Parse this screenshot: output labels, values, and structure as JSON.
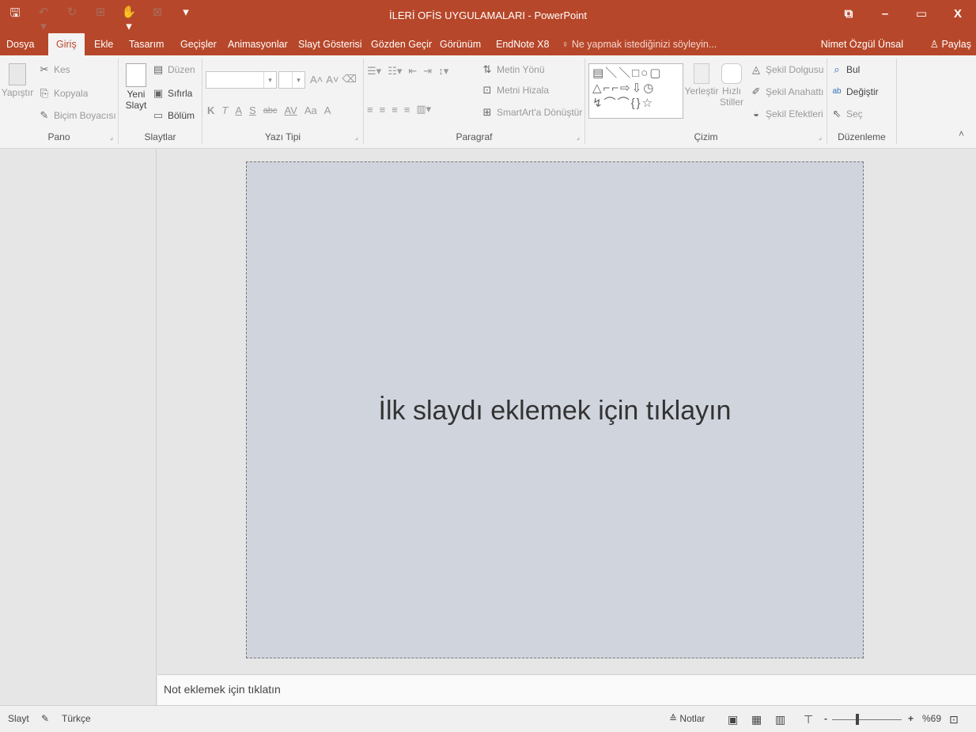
{
  "window": {
    "title": "İLERİ OFİS UYGULAMALARI - PowerPoint",
    "controls": [
      "⧉",
      "–",
      "▭",
      "X"
    ]
  },
  "qat": [
    "🖫",
    "↶ ▾",
    "↻",
    "⊞",
    "✋▾",
    "⊠",
    "▾"
  ],
  "tabs": [
    "Dosya",
    "Giriş",
    "Ekle",
    "Tasarım",
    "Geçişler",
    "Animasyonlar",
    "Slayt Gösterisi",
    "Gözden Geçir",
    "Görünüm",
    "EndNote X8"
  ],
  "active_tab": "Giriş",
  "tell_me": "Ne yapmak istediğinizi söyleyin...",
  "user": "Nimet Özgül Ünsal",
  "share_label": "Paylaş",
  "ribbon": {
    "pano": {
      "label": "Pano",
      "paste": "Yapıştır",
      "cut": "Kes",
      "copy": "Kopyala",
      "format_painter": "Biçim Boyacısı"
    },
    "slaytlar": {
      "label": "Slaytlar",
      "new_slide_1": "Yeni",
      "new_slide_2": "Slayt",
      "layout": "Düzen",
      "reset": "Sıfırla",
      "section": "Bölüm"
    },
    "yazi_tipi": {
      "label": "Yazı Tipi",
      "bold": "K",
      "italic": "T",
      "underline": "A",
      "shadow": "S",
      "strike": "abc",
      "spacing": "AV",
      "case": "Aa",
      "color": "A"
    },
    "paragraf": {
      "label": "Paragraf",
      "text_direction": "Metin Yönü",
      "align_text": "Metni Hizala",
      "smartart": "SmartArt'a Dönüştür"
    },
    "cizim": {
      "label": "Çizim",
      "arrange": "Yerleştir",
      "quick_styles_1": "Hızlı",
      "quick_styles_2": "Stiller",
      "fill": "Şekil Dolgusu",
      "outline": "Şekil Anahattı",
      "effects": "Şekil Efektleri"
    },
    "duzenleme": {
      "label": "Düzenleme",
      "find": "Bul",
      "replace": "Değiştir",
      "select": "Seç"
    }
  },
  "slide": {
    "placeholder": "İlk slaydı eklemek için tıklayın"
  },
  "notes_placeholder": "Not eklemek için tıklatın",
  "status": {
    "slide": "Slayt",
    "language": "Türkçe",
    "notes": "Notlar",
    "zoom": "%69",
    "zoom_fraction": 0.69
  }
}
